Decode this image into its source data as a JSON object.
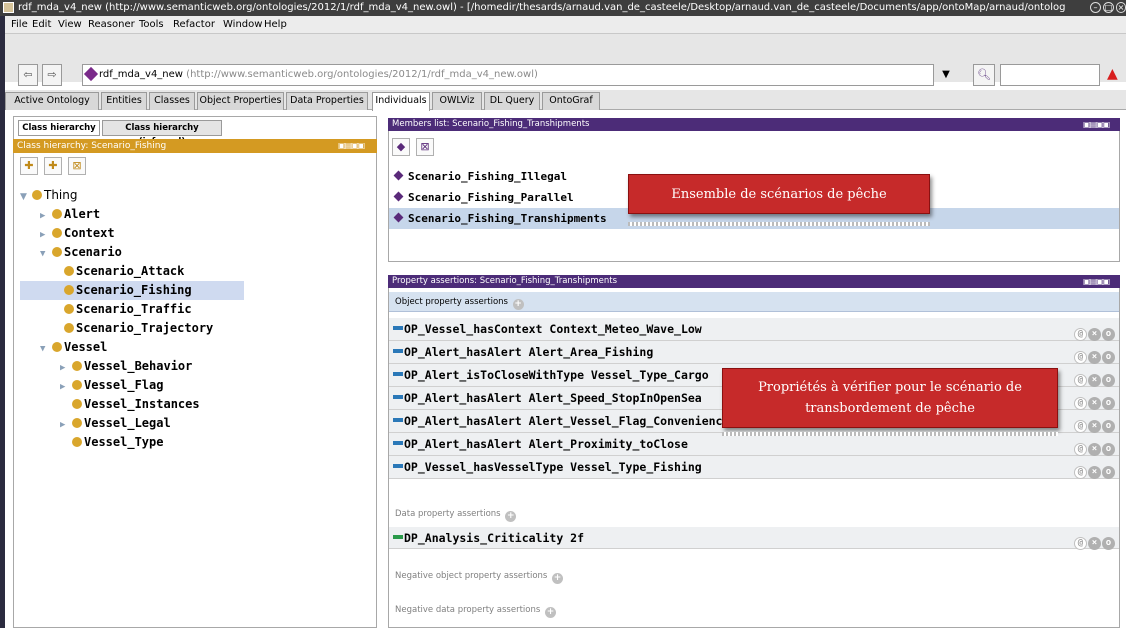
{
  "window": {
    "title": "rdf_mda_v4_new (http://www.semanticweb.org/ontologies/2012/1/rdf_mda_v4_new.owl) - [/homedir/thesards/arnaud.van_de_casteele/Desktop/arnaud.van_de_casteele/Documents/app/ontoMap/arnaud/ontolog"
  },
  "menu": [
    "File",
    "Edit",
    "View",
    "Reasoner",
    "Tools",
    "Refactor",
    "Window",
    "Help"
  ],
  "address": {
    "name": "rdf_mda_v4_new",
    "url": "(http://www.semanticweb.org/ontologies/2012/1/rdf_mda_v4_new.owl)",
    "search_value": ""
  },
  "tabs": [
    "Active Ontology",
    "Entities",
    "Classes",
    "Object Properties",
    "Data Properties",
    "Individuals",
    "OWLViz",
    "DL Query",
    "OntoGraf"
  ],
  "active_tab": "Individuals",
  "left_panel": {
    "subtabs": [
      "Class hierarchy",
      "Class hierarchy (inferred)"
    ],
    "header": "Class hierarchy: Scenario_Fishing",
    "tree": [
      {
        "label": "Thing",
        "expanded": true
      },
      {
        "label": "Alert",
        "expandable": true
      },
      {
        "label": "Context",
        "expandable": true
      },
      {
        "label": "Scenario",
        "expanded": true
      },
      {
        "label": "Scenario_Attack"
      },
      {
        "label": "Scenario_Fishing",
        "selected": true
      },
      {
        "label": "Scenario_Traffic"
      },
      {
        "label": "Scenario_Trajectory"
      },
      {
        "label": "Vessel",
        "expanded": true
      },
      {
        "label": "Vessel_Behavior",
        "expandable": true
      },
      {
        "label": "Vessel_Flag",
        "expandable": true
      },
      {
        "label": "Vessel_Instances"
      },
      {
        "label": "Vessel_Legal",
        "expandable": true
      },
      {
        "label": "Vessel_Type"
      }
    ]
  },
  "members": {
    "header": "Members list: Scenario_Fishing_Transhipments",
    "items": [
      "Scenario_Fishing_Illegal",
      "Scenario_Fishing_Parallel",
      "Scenario_Fishing_Transhipments"
    ],
    "selected": "Scenario_Fishing_Transhipments"
  },
  "properties": {
    "header": "Property assertions: Scenario_Fishing_Transhipments",
    "object_section": "Object property assertions",
    "object_assertions": [
      "OP_Vessel_hasContext Context_Meteo_Wave_Low",
      "OP_Alert_hasAlert Alert_Area_Fishing",
      "OP_Alert_isToCloseWithType Vessel_Type_Cargo",
      "OP_Alert_hasAlert Alert_Speed_StopInOpenSea",
      "OP_Alert_hasAlert Alert_Vessel_Flag_Convenience",
      "OP_Alert_hasAlert Alert_Proximity_toClose",
      "OP_Vessel_hasVesselType Vessel_Type_Fishing"
    ],
    "data_section": "Data property assertions",
    "data_assertions": [
      "DP_Analysis_Criticality 2f"
    ],
    "neg_object_section": "Negative object property assertions",
    "neg_data_section": "Negative data property assertions"
  },
  "annotations": {
    "members_note": "Ensemble de scénarios de pêche",
    "properties_note_line1": "Propriétés à vérifier pour le scénario de",
    "properties_note_line2": "transbordement de pêche"
  },
  "colors": {
    "class_header": "#d49a22",
    "individual_header": "#4c2c78",
    "annotation": "#c62a2a"
  }
}
